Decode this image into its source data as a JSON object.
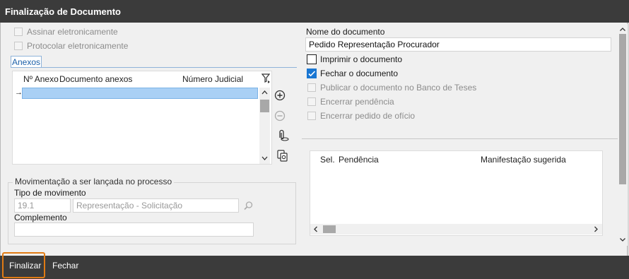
{
  "window": {
    "title": "Finalização de Documento"
  },
  "left": {
    "sign_checkbox_label": "Assinar eletronicamente",
    "protocol_checkbox_label": "Protocolar eletronicamente",
    "tab_label": "Anexos",
    "attachments_grid": {
      "columns": [
        "Nº Anexo",
        "Documento anexos",
        "Número Judicial"
      ],
      "row_marker": "→",
      "rows": []
    },
    "movement_group": {
      "legend": "Movimentação a ser lançada no processo",
      "type_label": "Tipo de movimento",
      "type_code": "19.1",
      "type_description": "Representação - Solicitação",
      "complement_label": "Complemento",
      "complement_value": ""
    }
  },
  "right": {
    "doc_name_label": "Nome do documento",
    "doc_name_value": "Pedido Representação Procurador",
    "options": [
      {
        "label": "Imprimir o documento",
        "checked": false,
        "enabled": true
      },
      {
        "label": "Fechar o documento",
        "checked": true,
        "enabled": true
      },
      {
        "label": "Publicar o documento no Banco de Teses",
        "checked": false,
        "enabled": false
      },
      {
        "label": "Encerrar pendência",
        "checked": false,
        "enabled": false
      },
      {
        "label": "Encerrar pedido de ofício",
        "checked": false,
        "enabled": false
      }
    ],
    "pendencies_grid": {
      "columns": [
        "Sel.",
        "Pendência",
        "Manifestação sugerida"
      ],
      "rows": []
    }
  },
  "footer": {
    "finalize_label": "Finalizar",
    "close_label": "Fechar"
  },
  "colors": {
    "titlebar": "#3b3b3b",
    "accent": "#1976d2",
    "focus_outline": "#e07b14",
    "selection": "#a9d0f5"
  }
}
